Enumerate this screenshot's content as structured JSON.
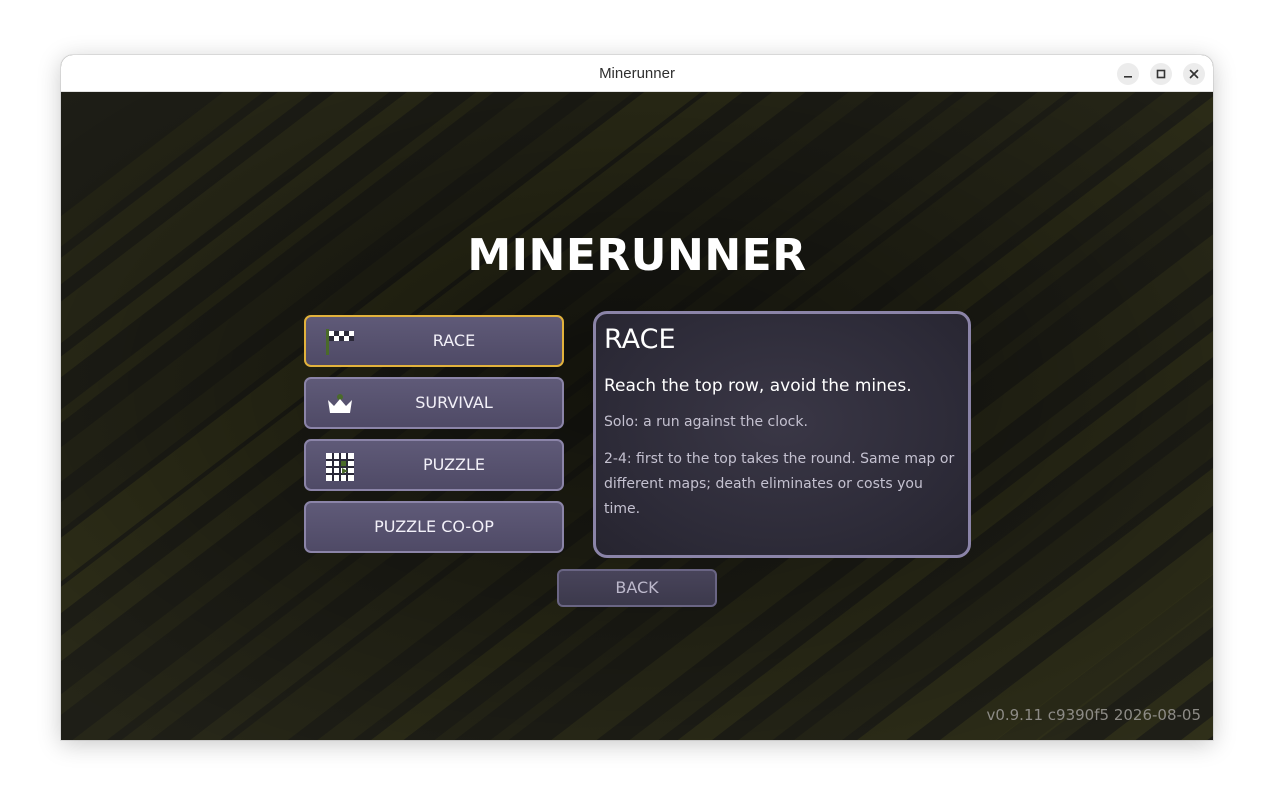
{
  "window": {
    "title": "Minerunner"
  },
  "game": {
    "logo": "MINERUNNER",
    "modes": [
      {
        "label": "RACE",
        "icon": "checkered-flag-icon",
        "selected": true
      },
      {
        "label": "SURVIVAL",
        "icon": "crown-icon",
        "selected": false
      },
      {
        "label": "PUZZLE",
        "icon": "grid-puzzle-icon",
        "selected": false
      },
      {
        "label": "PUZZLE CO-OP",
        "icon": "",
        "selected": false
      }
    ],
    "detail": {
      "title": "RACE",
      "tagline": "Reach the top row, avoid the mines.",
      "solo": "Solo: a run against the clock.",
      "multi": "2-4: first to the top takes the round. Same map or different maps; death eliminates or costs you time."
    },
    "back_label": "BACK",
    "version": "v0.9.11 c9390f5 2026-08-05"
  },
  "colors": {
    "selected_border": "#e2b23c",
    "button_border": "#8b84a8",
    "button_fill": "#56516e",
    "background": "#1d1d16",
    "stripe": "#3a3a1c"
  }
}
